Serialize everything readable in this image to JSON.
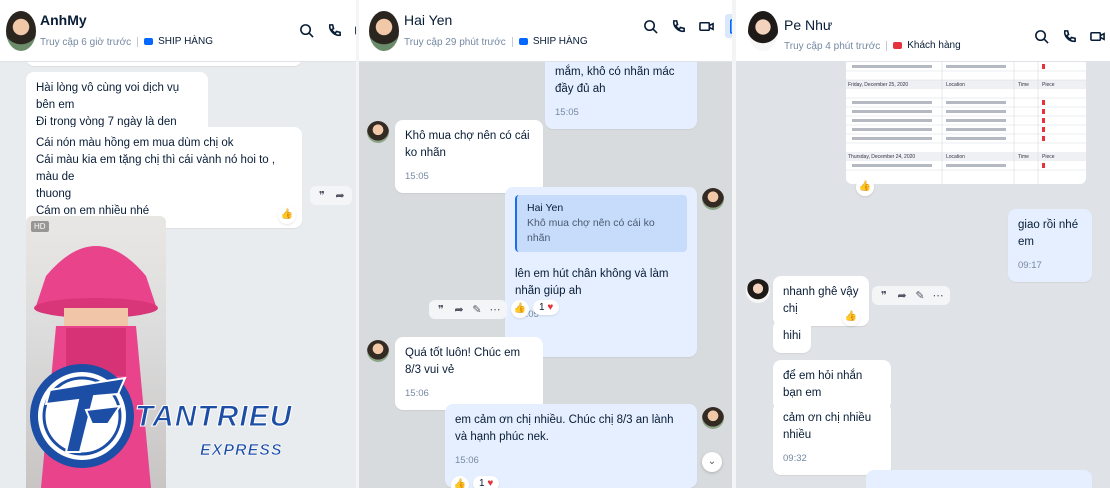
{
  "panels": [
    {
      "name": "AnhMy",
      "status": "Truy cập 6 giờ trước",
      "tag": "SHIP HÀNG",
      "tag_color": "#0068ff",
      "messages": [
        {
          "lines": [
            "Hài lòng vô cùng voi dịch vụ bên em",
            "Đi trong vòng 7 ngày là den"
          ]
        },
        {
          "lines": [
            "Cái nón màu hồng em mua dùm chị ok",
            "Cái màu kia em tặng chị thì cái vành nó hoi to , màu de",
            "thuong",
            "Cám on em nhiều nhé"
          ]
        }
      ],
      "photo_badge": "HD"
    },
    {
      "name": "Hai Yen",
      "status": "Truy cập 29 phút trước",
      "tag": "SHIP HÀNG",
      "tag_color": "#0068ff",
      "messages": [
        {
          "text": "mắm, khô có nhãn mác đầy đủ ah",
          "time": "15:05"
        },
        {
          "text": "Khô mua chợ nên có cái ko nhãn",
          "time": "15:05"
        },
        {
          "quote_name": "Hai Yen",
          "quote_text": "Khô mua chợ nên có cái ko nhãn",
          "text": "lên em hút chân không và làm nhãn giúp ah",
          "time": "15:05",
          "reaction": "1"
        },
        {
          "text": "Quá tốt luôn! Chúc em 8/3 vui vẻ",
          "time": "15:06"
        },
        {
          "text": "em cảm ơn chị nhiều. Chúc chị 8/3 an lành và hạnh phúc nek.",
          "time": "15:06",
          "reaction": "1"
        }
      ]
    },
    {
      "name": "Pe Như",
      "status": "Truy cập 4 phút trước",
      "tag": "Khách hàng",
      "tag_color": "#e5323d",
      "messages": [
        {
          "text": "giao rồi nhé em",
          "time": "09:17"
        },
        {
          "text": "nhanh ghê vậy chị"
        },
        {
          "text": "hihi"
        },
        {
          "text": "để em hỏi nhắn bạn em"
        },
        {
          "text": "cảm ơn chị nhiều nhiều",
          "time": "09:32"
        }
      ],
      "doc_rows": [
        {
          "date": "Friday, December 25, 2020",
          "loc": "Location",
          "time": "Time",
          "piece": "Piece"
        },
        {
          "date": "Thursday, December 24, 2020",
          "loc": "Location",
          "time": "Time",
          "piece": "Piece"
        }
      ]
    }
  ],
  "logo": {
    "brand": "TANTRIEU",
    "sub": "EXPRESS"
  },
  "colors": {
    "accent": "#0068ff",
    "logo": "#1c4ea6",
    "hat": "#e8438b"
  }
}
